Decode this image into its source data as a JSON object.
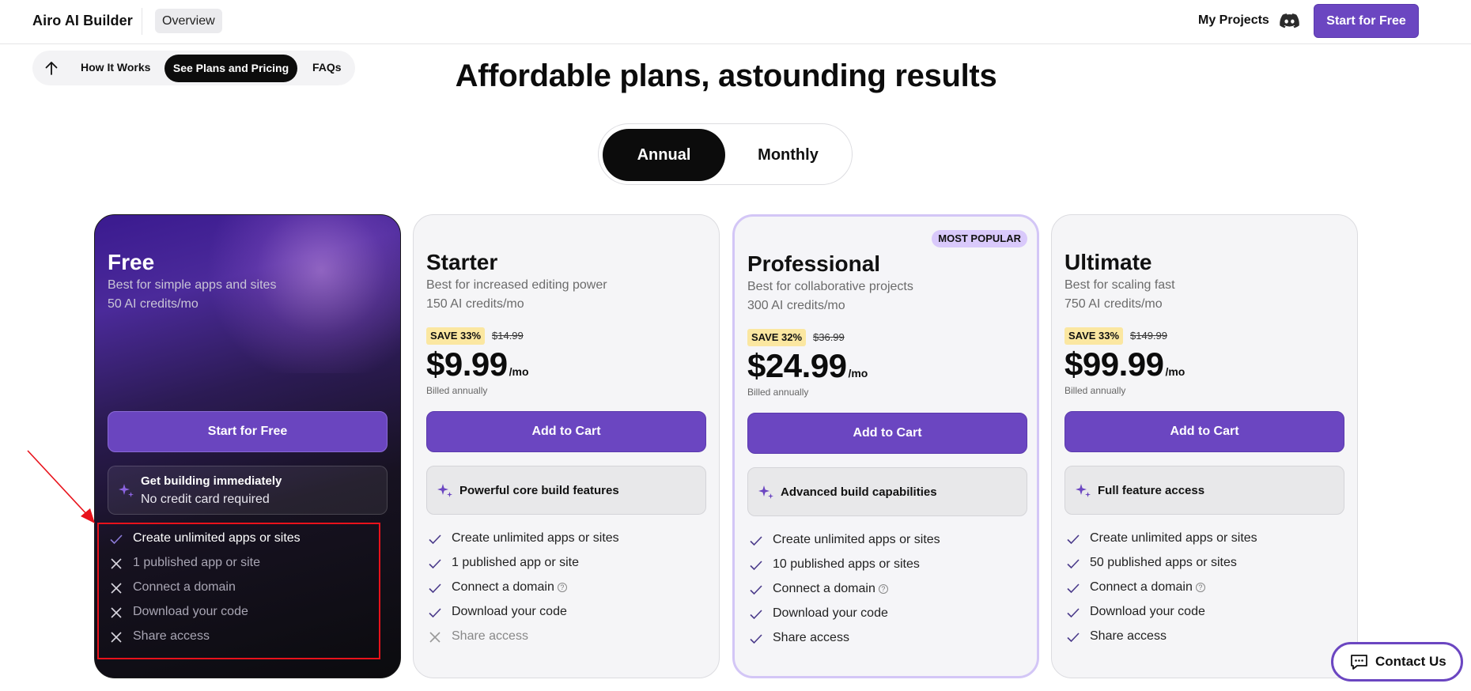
{
  "header": {
    "brand": "Airo AI Builder",
    "overview": "Overview",
    "my_projects": "My Projects",
    "cta": "Start for Free",
    "discord_icon": "discord-icon"
  },
  "subnav": {
    "up_icon": "arrow-up-icon",
    "how_it_works": "How It Works",
    "active": "See Plans and Pricing",
    "faqs": "FAQs"
  },
  "headline": "Affordable plans, astounding results",
  "billing_toggle": {
    "options": [
      "Annual",
      "Monthly"
    ],
    "selected": "Annual"
  },
  "plans": [
    {
      "name": "Free",
      "description": "Best for simple apps and sites",
      "credits": "50 AI credits/mo",
      "cta": "Start for Free",
      "feature_title": "Get building immediately",
      "feature_subtitle": "No credit card required",
      "features": [
        {
          "text": "Create unlimited apps or sites",
          "included": true
        },
        {
          "text": "1 published app or site",
          "included": false
        },
        {
          "text": "Connect a domain",
          "included": false
        },
        {
          "text": "Download your code",
          "included": false
        },
        {
          "text": "Share access",
          "included": false
        }
      ]
    },
    {
      "name": "Starter",
      "description": "Best for increased editing power",
      "credits": "150 AI credits/mo",
      "save": "SAVE 33%",
      "was": "$14.99",
      "price": "$9.99",
      "per": "/mo",
      "billed": "Billed annually",
      "cta": "Add to Cart",
      "feature_title": "Powerful core build features",
      "features": [
        {
          "text": "Create unlimited apps or sites",
          "included": true
        },
        {
          "text": "1 published app or site",
          "included": true
        },
        {
          "text": "Connect a domain",
          "included": true,
          "info": "?"
        },
        {
          "text": "Download your code",
          "included": true
        },
        {
          "text": "Share access",
          "included": false
        }
      ]
    },
    {
      "name": "Professional",
      "badge": "MOST POPULAR",
      "description": "Best for collaborative projects",
      "credits": "300 AI credits/mo",
      "save": "SAVE 32%",
      "was": "$36.99",
      "price": "$24.99",
      "per": "/mo",
      "billed": "Billed annually",
      "cta": "Add to Cart",
      "feature_title": "Advanced build capabilities",
      "features": [
        {
          "text": "Create unlimited apps or sites",
          "included": true
        },
        {
          "text": "10 published apps or sites",
          "included": true
        },
        {
          "text": "Connect a domain",
          "included": true,
          "info": "?"
        },
        {
          "text": "Download your code",
          "included": true
        },
        {
          "text": "Share access",
          "included": true
        }
      ]
    },
    {
      "name": "Ultimate",
      "description": "Best for scaling fast",
      "credits": "750 AI credits/mo",
      "save": "SAVE 33%",
      "was": "$149.99",
      "price": "$99.99",
      "per": "/mo",
      "billed": "Billed annually",
      "cta": "Add to Cart",
      "feature_title": "Full feature access",
      "features": [
        {
          "text": "Create unlimited apps or sites",
          "included": true
        },
        {
          "text": "50 published apps or sites",
          "included": true
        },
        {
          "text": "Connect a domain",
          "included": true,
          "info": "?"
        },
        {
          "text": "Download your code",
          "included": true
        },
        {
          "text": "Share access",
          "included": true
        }
      ]
    }
  ],
  "contact": {
    "label": "Contact Us",
    "icon": "chat-bubble-icon"
  },
  "colors": {
    "accent": "#6b46c1",
    "badge": "#d9c9fb",
    "save_tag": "#fbe7a1",
    "annotation": "#e8121b"
  }
}
